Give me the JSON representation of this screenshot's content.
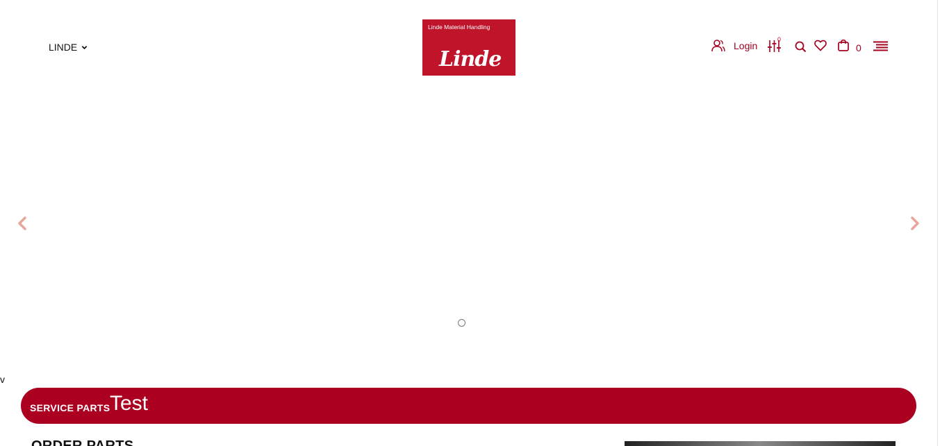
{
  "header": {
    "brand_select": "LINDE",
    "logo": {
      "tagline": "Linde Material Handling",
      "wordmark": "Linde",
      "bg_color": "#c0142b"
    },
    "login_label": "Login",
    "compare_count": "0",
    "cart_count": "0",
    "icons": [
      "user-icon",
      "compare-sliders-icon",
      "search-icon",
      "heart-icon",
      "cart-bag-icon",
      "menu-icon"
    ]
  },
  "slider": {
    "prev_icon": "chevron-left-icon",
    "next_icon": "chevron-right-icon",
    "arrow_color": "#e8a69b"
  },
  "stray_text": "v",
  "banner": {
    "small_label": "SERVICE PARTS",
    "big_label": "Test",
    "bg_color": "#ab0020"
  },
  "section": {
    "heading": "ORDER PARTS"
  },
  "accent_color": "#a6001f"
}
